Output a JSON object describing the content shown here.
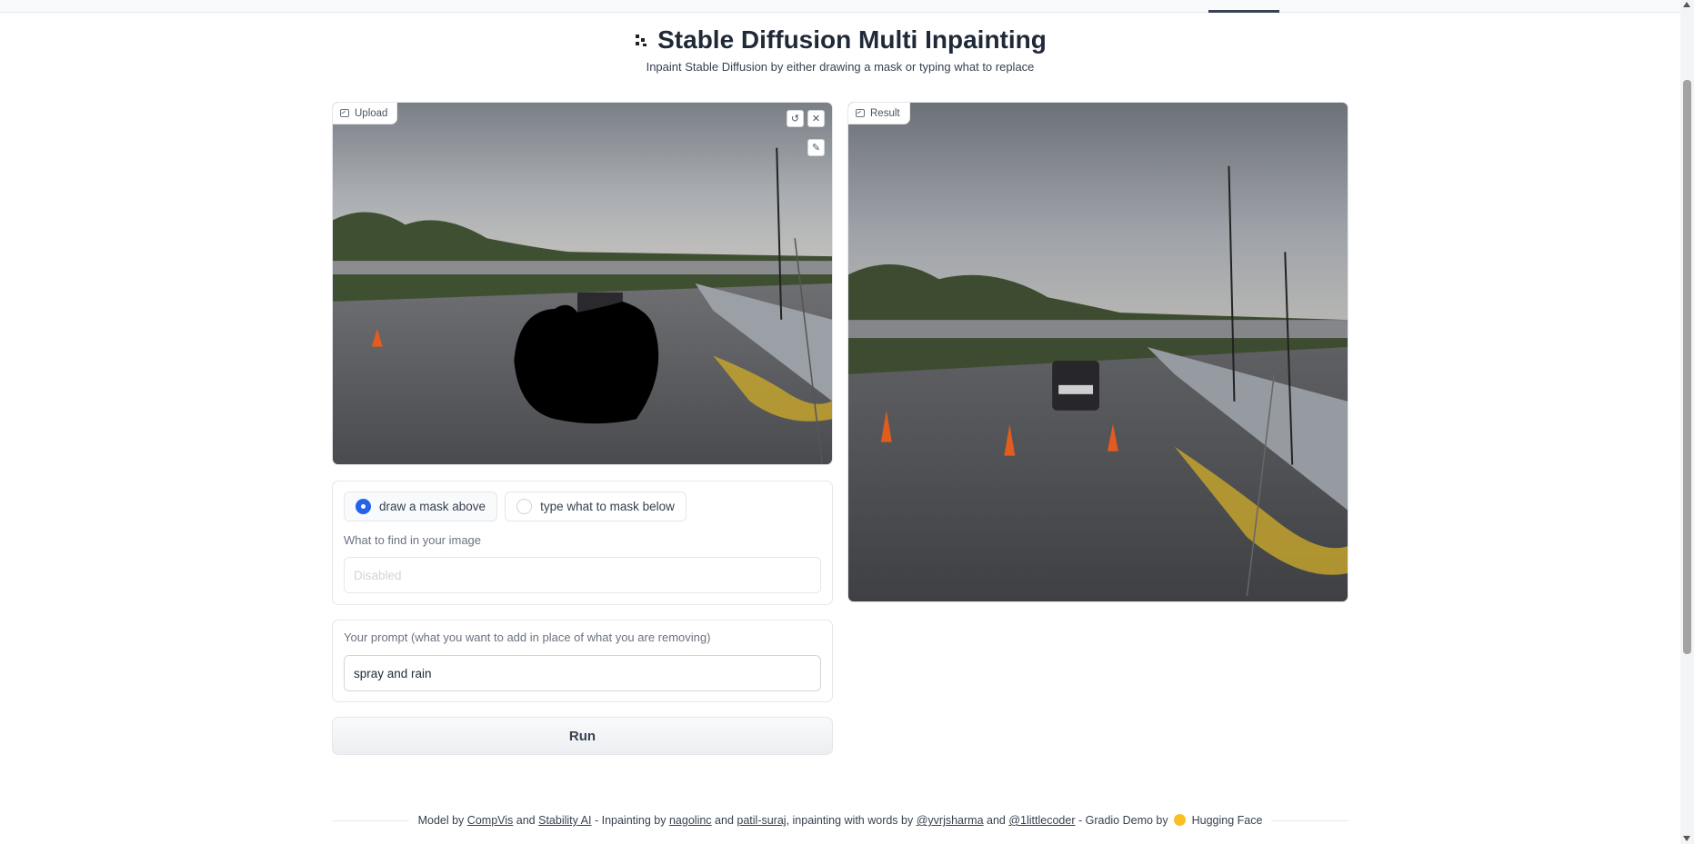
{
  "header": {
    "title": "Stable Diffusion Multi Inpainting",
    "subtitle": "Inpaint Stable Diffusion by either drawing a mask or typing what to replace"
  },
  "upload_panel": {
    "label": "Upload",
    "undo_icon": "undo-icon",
    "clear_icon": "close-icon",
    "brush_icon": "brush-icon"
  },
  "result_panel": {
    "label": "Result"
  },
  "mask_mode": {
    "options": [
      "draw a mask above",
      "type what to mask below"
    ],
    "selected": "draw a mask above"
  },
  "find_field": {
    "label": "What to find in your image",
    "placeholder": "Disabled",
    "value": ""
  },
  "prompt_field": {
    "label": "Your prompt (what you want to add in place of what you are removing)",
    "value": "spray and rain"
  },
  "run_button": {
    "label": "Run"
  },
  "footer": {
    "t1": "Model by",
    "l1": "CompVis",
    "t2": "and",
    "l2": "Stability AI",
    "t3": "- Inpainting by",
    "l3": "nagolinc",
    "t4": "and",
    "l4": "patil-suraj",
    "t5": ", inpainting with words by",
    "l5": "@yvrjsharma",
    "t6": "and",
    "l6": "@1littlecoder",
    "t7": "- Gradio Demo by",
    "t8": "Hugging Face"
  },
  "colors": {
    "accent": "#2563eb",
    "text": "#374151",
    "border": "#e5e7eb"
  }
}
